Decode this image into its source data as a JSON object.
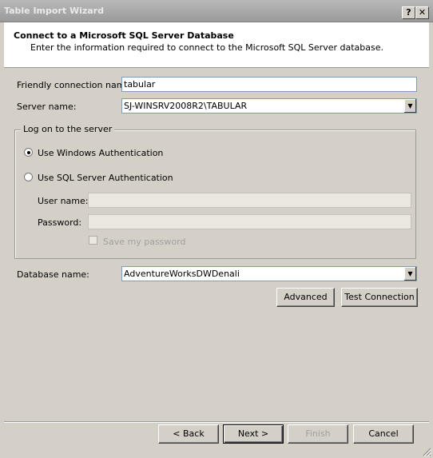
{
  "window": {
    "title": "Table Import Wizard",
    "help_glyph": "?",
    "close_glyph": "✕"
  },
  "header": {
    "title": "Connect to a Microsoft SQL Server Database",
    "description": "Enter the information required to connect to the Microsoft SQL Server database."
  },
  "form": {
    "friendly_name_label": "Friendly connection name:",
    "friendly_name_value": "tabular",
    "server_name_label": "Server name:",
    "server_name_value": "SJ-WINSRV2008R2\\TABULAR",
    "logon_group_label": "Log on to the server",
    "windows_auth_label": "Use Windows Authentication",
    "windows_auth_selected": true,
    "sql_auth_label": "Use SQL Server Authentication",
    "sql_auth_selected": false,
    "username_label": "User name:",
    "username_value": "",
    "password_label": "Password:",
    "password_value": "",
    "save_password_label": "Save my password",
    "database_name_label": "Database name:",
    "database_name_value": "AdventureWorksDWDenali"
  },
  "buttons": {
    "advanced": "Advanced",
    "test_connection": "Test Connection",
    "back": "< Back",
    "next": "Next >",
    "finish": "Finish",
    "cancel": "Cancel"
  },
  "icons": {
    "dropdown": "▼"
  }
}
